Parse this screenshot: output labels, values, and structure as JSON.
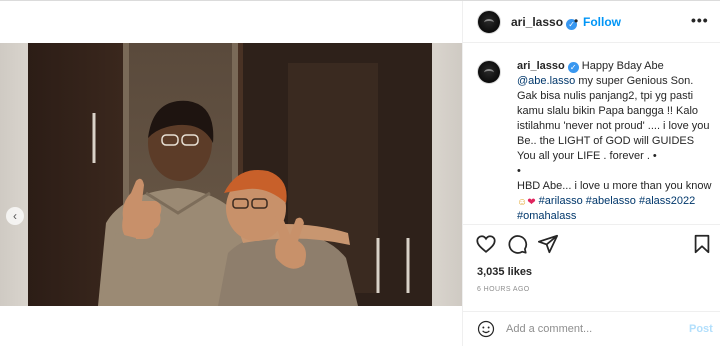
{
  "post": {
    "username": "ari_lasso",
    "verified_icon": "verified-badge-icon",
    "follow_label": "Follow",
    "separator": "•",
    "more_label": "•••"
  },
  "caption": {
    "username": "ari_lasso",
    "line1": "Happy Bday Abe",
    "mention": "@abe.lasso",
    "line2": " my super Genious Son. Gak bisa nulis panjang2, tpi yg pasti kamu slalu bikin Papa bangga !! Kalo istilahmu 'never not proud' .... i love you Be.. the LIGHT of GOD will GUIDES You all your LIFE . forever . •",
    "bullet": "•",
    "line3": "HBD Abe... i love u more than you know ",
    "emoji_face": "☺",
    "emoji_heart": "❤",
    "hashtags": [
      "#arilasso",
      "#abelasso",
      "#alass2022",
      "#omahalass"
    ]
  },
  "stats": {
    "likes": "3,035 likes",
    "time": "6 HOURS AGO"
  },
  "comment_box": {
    "placeholder": "Add a comment...",
    "post_label": "Post"
  },
  "carousel": {
    "dot_count": 8,
    "active_index": 7
  },
  "icons": {
    "like": "heart-icon",
    "comment": "comment-icon",
    "share": "share-icon",
    "save": "bookmark-icon",
    "emoji": "emoji-icon",
    "prev": "chevron-left-icon"
  },
  "colors": {
    "accent": "#0095f6",
    "verified": "#3897f0",
    "link": "#00376b",
    "muted": "#8e8e8e",
    "post_disabled": "#b2dffc"
  }
}
